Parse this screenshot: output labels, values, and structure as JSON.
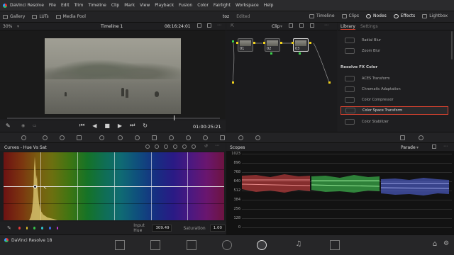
{
  "menubar": {
    "items": [
      "DaVinci Resolve",
      "File",
      "Edit",
      "Trim",
      "Timeline",
      "Clip",
      "Mark",
      "View",
      "Playback",
      "Fusion",
      "Color",
      "Fairlight",
      "Workspace",
      "Help"
    ]
  },
  "toolbar": {
    "gallery": "Gallery",
    "luts": "LUTs",
    "media_pool": "Media Pool",
    "project": "toz",
    "project_state": "Edited",
    "timeline": "Timeline",
    "clips": "Clips",
    "nodes": "Nodes",
    "effects": "Effects",
    "lightbox": "Lightbox"
  },
  "viewer": {
    "zoom": "30%",
    "timeline_name": "Timeline 1",
    "source_timecode": "08:16:24:01",
    "record_timecode": "01:00:25:21"
  },
  "nodes": {
    "mode": "Clip",
    "items": [
      "01",
      "02",
      "03"
    ]
  },
  "library": {
    "tab_library": "Library",
    "tab_settings": "Settings",
    "items_top": [
      "Radial Blur",
      "Zoom Blur"
    ],
    "section": "Resolve FX Color",
    "items": [
      "ACES Transform",
      "Chromatic Adaptation",
      "Color Compressor",
      "Color Space Transform",
      "Color Stabilizer"
    ],
    "selected": "Color Space Transform"
  },
  "curves": {
    "title": "Curves - Hue Vs Sat",
    "input_hue_label": "Input Hue",
    "input_hue_value": "309.49",
    "saturation_label": "Saturation",
    "saturation_value": "1.00",
    "color_dots": [
      "#e23b3b",
      "#e0c12a",
      "#35c24a",
      "#2fc0c9",
      "#3a6ce8",
      "#c33ad0"
    ]
  },
  "scopes": {
    "title": "Scopes",
    "mode": "Parade",
    "scale": [
      "1023",
      "896",
      "768",
      "640",
      "512",
      "384",
      "256",
      "128",
      "0"
    ]
  },
  "footer": {
    "app_version": "DaVinci Resolve 18"
  },
  "colors": {
    "accent_red": "#d8422f",
    "node_link": "#f1d21b"
  }
}
